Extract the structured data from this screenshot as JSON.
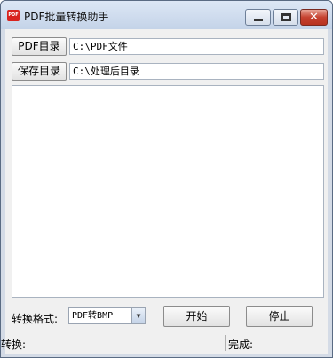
{
  "window": {
    "title": "PDF批量转换助手",
    "icon": "pdf-app-icon",
    "icon_label": "PDF",
    "controls": {
      "minimize": "minimize-icon",
      "maximize": "maximize-icon",
      "close": "✕"
    }
  },
  "paths": {
    "pdf_dir_button": "PDF目录",
    "pdf_dir_value": "C:\\PDF文件",
    "save_dir_button": "保存目录",
    "save_dir_value": "C:\\处理后目录"
  },
  "log": {
    "lines": []
  },
  "format": {
    "label": "转换格式:",
    "selected": "PDF转BMP"
  },
  "actions": {
    "start": "开始",
    "stop": "停止"
  },
  "status": {
    "converting": "转换:",
    "done": "完成:"
  },
  "colors": {
    "close_button": "#c64230",
    "titlebar": "#c4d3e8",
    "client": "#f0f0f0"
  }
}
